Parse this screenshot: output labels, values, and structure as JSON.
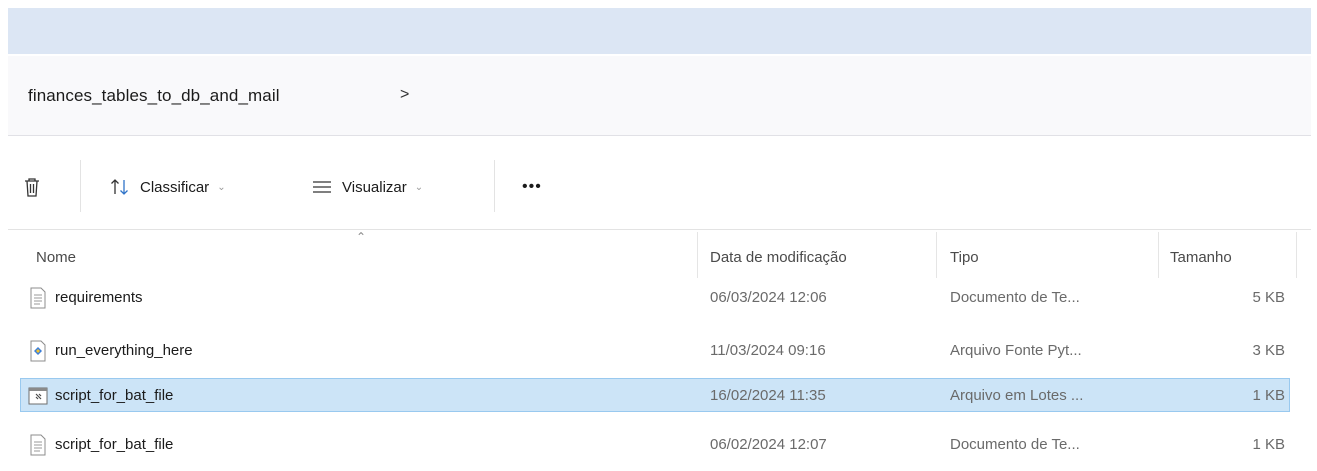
{
  "breadcrumb": {
    "folder": "finances_tables_to_db_and_mail",
    "separator": ">"
  },
  "toolbar": {
    "sort_label": "Classificar",
    "view_label": "Visualizar",
    "more_label": "•••"
  },
  "columns": {
    "name": "Nome",
    "modified": "Data de modificação",
    "type": "Tipo",
    "size": "Tamanho"
  },
  "files": [
    {
      "name": "requirements",
      "modified": "06/03/2024 12:06",
      "type": "Documento de Te...",
      "size": "5 KB",
      "icon": "text-file-icon",
      "selected": false
    },
    {
      "name": "run_everything_here",
      "modified": "11/03/2024 09:16",
      "type": "Arquivo Fonte Pyt...",
      "size": "3 KB",
      "icon": "python-file-icon",
      "selected": false
    },
    {
      "name": "script_for_bat_file",
      "modified": "16/02/2024 11:35",
      "type": "Arquivo em Lotes ...",
      "size": "1 KB",
      "icon": "batch-file-icon",
      "selected": true
    },
    {
      "name": "script_for_bat_file",
      "modified": "06/02/2024 12:07",
      "type": "Documento de Te...",
      "size": "1 KB",
      "icon": "text-file-icon",
      "selected": false
    }
  ],
  "colors": {
    "selection": "#cce4f7",
    "selection_border": "#99c9ef",
    "title_strip": "#dce6f4"
  }
}
